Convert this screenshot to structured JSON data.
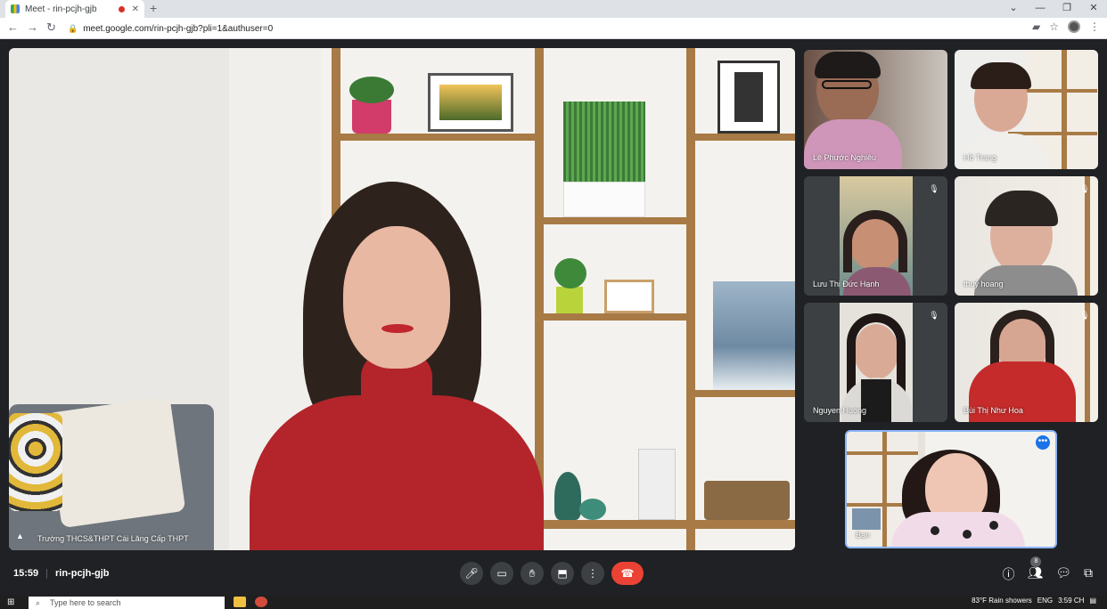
{
  "browser": {
    "tab_title": "Meet - rin-pcjh-gjb",
    "tab_close": "✕",
    "new_tab": "+",
    "url": "meet.google.com/rin-pcjh-gjb?pli=1&authuser=0",
    "window_controls": [
      "⌄",
      "—",
      "❐",
      "✕"
    ]
  },
  "main_video": {
    "participant_name": "Trường THCS&THPT Cái Lăng Cấp THPT"
  },
  "tiles": [
    {
      "name": "Lê Phước Nghiêu",
      "muted": false
    },
    {
      "name": "Hồ Trang",
      "muted": false
    },
    {
      "name": "Lưu Thị Đức Hạnh",
      "muted": true
    },
    {
      "name": "thuỷ hoang",
      "muted": true
    },
    {
      "name": "Nguyen Huong",
      "muted": true
    },
    {
      "name": "Bùi Thị Như Hoa",
      "muted": true
    }
  ],
  "self_tile": {
    "name": "Bạn"
  },
  "bottom_bar": {
    "time": "15:59",
    "separator": "|",
    "meeting_code": "rin-pcjh-gjb",
    "participant_count": "8"
  },
  "taskbar": {
    "search_placeholder": "Type here to search",
    "weather": "83°F  Rain showers",
    "lang": "ENG",
    "clock": "3:59 CH"
  },
  "colors": {
    "meet_bg": "#202124",
    "end_call": "#ea4335",
    "self_border": "#8ab4f8",
    "accent": "#1a73e8"
  }
}
